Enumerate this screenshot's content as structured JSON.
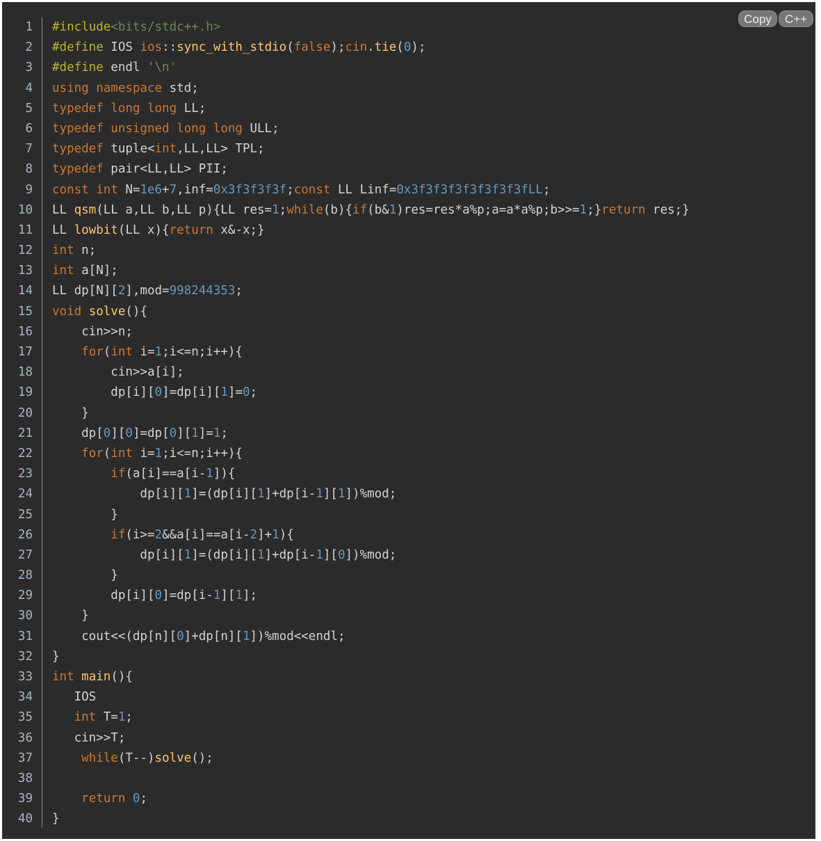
{
  "toolbar": {
    "copy_label": "Copy",
    "language_label": "C++"
  },
  "colors": {
    "background": "#2b2b2b",
    "line_numbers": "#a9b7c6",
    "keyword": "#cc7832",
    "preprocessor": "#bbb529",
    "string": "#6a8759",
    "number": "#6897bb",
    "function": "#ffc66d",
    "default": "#d4d4d4"
  },
  "lines": [
    [
      [
        "pp",
        "#include"
      ],
      [
        "hdr",
        "<bits/stdc++.h>"
      ]
    ],
    [
      [
        "pp",
        "#define"
      ],
      [
        "default",
        " IOS "
      ],
      [
        "kw",
        "ios"
      ],
      [
        "default",
        "::"
      ],
      [
        "fn",
        "sync_with_stdio"
      ],
      [
        "default",
        "("
      ],
      [
        "kw",
        "false"
      ],
      [
        "default",
        ");"
      ],
      [
        "kw",
        "cin"
      ],
      [
        "default",
        "."
      ],
      [
        "fn",
        "tie"
      ],
      [
        "default",
        "("
      ],
      [
        "num",
        "0"
      ],
      [
        "default",
        ");"
      ]
    ],
    [
      [
        "pp",
        "#define"
      ],
      [
        "default",
        " endl "
      ],
      [
        "str",
        "'\\n'"
      ]
    ],
    [
      [
        "kw",
        "using namespace"
      ],
      [
        "default",
        " std;"
      ]
    ],
    [
      [
        "kw",
        "typedef long long"
      ],
      [
        "default",
        " LL;"
      ]
    ],
    [
      [
        "kw",
        "typedef unsigned long long"
      ],
      [
        "default",
        " ULL;"
      ]
    ],
    [
      [
        "kw",
        "typedef"
      ],
      [
        "default",
        " tuple<"
      ],
      [
        "kw",
        "int"
      ],
      [
        "default",
        ",LL,LL> TPL;"
      ]
    ],
    [
      [
        "kw",
        "typedef"
      ],
      [
        "default",
        " pair<LL,LL> PII;"
      ]
    ],
    [
      [
        "kw",
        "const int"
      ],
      [
        "default",
        " N="
      ],
      [
        "num",
        "1e6"
      ],
      [
        "default",
        "+"
      ],
      [
        "num",
        "7"
      ],
      [
        "default",
        ",inf="
      ],
      [
        "num",
        "0x3f3f3f3f"
      ],
      [
        "default",
        ";"
      ],
      [
        "kw",
        "const"
      ],
      [
        "default",
        " LL Linf="
      ],
      [
        "num",
        "0x3f3f3f3f3f3f3f3fLL"
      ],
      [
        "default",
        ";"
      ]
    ],
    [
      [
        "default",
        "LL "
      ],
      [
        "fn",
        "qsm"
      ],
      [
        "default",
        "(LL a,LL b,LL p){LL res="
      ],
      [
        "num",
        "1"
      ],
      [
        "default",
        ";"
      ],
      [
        "kw",
        "while"
      ],
      [
        "default",
        "(b){"
      ],
      [
        "kw",
        "if"
      ],
      [
        "default",
        "(b&"
      ],
      [
        "num",
        "1"
      ],
      [
        "default",
        ")res=res*a%p;a=a*a%p;b>>="
      ],
      [
        "num",
        "1"
      ],
      [
        "default",
        ";}"
      ],
      [
        "kw",
        "return"
      ],
      [
        "default",
        " res;}"
      ]
    ],
    [
      [
        "default",
        "LL "
      ],
      [
        "fn",
        "lowbit"
      ],
      [
        "default",
        "(LL x){"
      ],
      [
        "kw",
        "return"
      ],
      [
        "default",
        " x&-x;}"
      ]
    ],
    [
      [
        "kw",
        "int"
      ],
      [
        "default",
        " n;"
      ]
    ],
    [
      [
        "kw",
        "int"
      ],
      [
        "default",
        " a[N];"
      ]
    ],
    [
      [
        "default",
        "LL dp[N]["
      ],
      [
        "num",
        "2"
      ],
      [
        "default",
        "],mod="
      ],
      [
        "num",
        "998244353"
      ],
      [
        "default",
        ";"
      ]
    ],
    [
      [
        "kw",
        "void"
      ],
      [
        "default",
        " "
      ],
      [
        "fn",
        "solve"
      ],
      [
        "default",
        "(){"
      ]
    ],
    [
      [
        "default",
        "    cin>>n;"
      ]
    ],
    [
      [
        "default",
        "    "
      ],
      [
        "kw",
        "for"
      ],
      [
        "default",
        "("
      ],
      [
        "kw",
        "int"
      ],
      [
        "default",
        " i="
      ],
      [
        "num",
        "1"
      ],
      [
        "default",
        ";i<=n;i++){"
      ]
    ],
    [
      [
        "default",
        "        cin>>a[i];"
      ]
    ],
    [
      [
        "default",
        "        dp[i]["
      ],
      [
        "num",
        "0"
      ],
      [
        "default",
        "]=dp[i]["
      ],
      [
        "num",
        "1"
      ],
      [
        "default",
        "]="
      ],
      [
        "num",
        "0"
      ],
      [
        "default",
        ";"
      ]
    ],
    [
      [
        "default",
        "    }"
      ]
    ],
    [
      [
        "default",
        "    dp["
      ],
      [
        "num",
        "0"
      ],
      [
        "default",
        "]["
      ],
      [
        "num",
        "0"
      ],
      [
        "default",
        "]=dp["
      ],
      [
        "num",
        "0"
      ],
      [
        "default",
        "]["
      ],
      [
        "num",
        "1"
      ],
      [
        "default",
        "]="
      ],
      [
        "num",
        "1"
      ],
      [
        "default",
        ";"
      ]
    ],
    [
      [
        "default",
        "    "
      ],
      [
        "kw",
        "for"
      ],
      [
        "default",
        "("
      ],
      [
        "kw",
        "int"
      ],
      [
        "default",
        " i="
      ],
      [
        "num",
        "1"
      ],
      [
        "default",
        ";i<=n;i++){"
      ]
    ],
    [
      [
        "default",
        "        "
      ],
      [
        "kw",
        "if"
      ],
      [
        "default",
        "(a[i]==a[i-"
      ],
      [
        "num",
        "1"
      ],
      [
        "default",
        "]){"
      ]
    ],
    [
      [
        "default",
        "            dp[i]["
      ],
      [
        "num",
        "1"
      ],
      [
        "default",
        "]=(dp[i]["
      ],
      [
        "num",
        "1"
      ],
      [
        "default",
        "]+dp[i-"
      ],
      [
        "num",
        "1"
      ],
      [
        "default",
        "]["
      ],
      [
        "num",
        "1"
      ],
      [
        "default",
        "])%mod;"
      ]
    ],
    [
      [
        "default",
        "        }"
      ]
    ],
    [
      [
        "default",
        "        "
      ],
      [
        "kw",
        "if"
      ],
      [
        "default",
        "(i>="
      ],
      [
        "num",
        "2"
      ],
      [
        "default",
        "&&a[i]==a[i-"
      ],
      [
        "num",
        "2"
      ],
      [
        "default",
        "]+"
      ],
      [
        "num",
        "1"
      ],
      [
        "default",
        "){"
      ]
    ],
    [
      [
        "default",
        "            dp[i]["
      ],
      [
        "num",
        "1"
      ],
      [
        "default",
        "]=(dp[i]["
      ],
      [
        "num",
        "1"
      ],
      [
        "default",
        "]+dp[i-"
      ],
      [
        "num",
        "1"
      ],
      [
        "default",
        "]["
      ],
      [
        "num",
        "0"
      ],
      [
        "default",
        "])%mod;"
      ]
    ],
    [
      [
        "default",
        "        }"
      ]
    ],
    [
      [
        "default",
        "        dp[i]["
      ],
      [
        "num",
        "0"
      ],
      [
        "default",
        "]=dp[i-"
      ],
      [
        "num",
        "1"
      ],
      [
        "default",
        "]["
      ],
      [
        "num",
        "1"
      ],
      [
        "default",
        "];"
      ]
    ],
    [
      [
        "default",
        "    }"
      ]
    ],
    [
      [
        "default",
        "    cout<<(dp[n]["
      ],
      [
        "num",
        "0"
      ],
      [
        "default",
        "]+dp[n]["
      ],
      [
        "num",
        "1"
      ],
      [
        "default",
        "])%mod<<endl;"
      ]
    ],
    [
      [
        "default",
        "}"
      ]
    ],
    [
      [
        "kw",
        "int"
      ],
      [
        "default",
        " "
      ],
      [
        "fn",
        "main"
      ],
      [
        "default",
        "(){"
      ]
    ],
    [
      [
        "default",
        "   IOS"
      ]
    ],
    [
      [
        "default",
        "   "
      ],
      [
        "kw",
        "int"
      ],
      [
        "default",
        " T="
      ],
      [
        "num",
        "1"
      ],
      [
        "default",
        ";"
      ]
    ],
    [
      [
        "default",
        "   cin>>T;"
      ]
    ],
    [
      [
        "default",
        "    "
      ],
      [
        "kw",
        "while"
      ],
      [
        "default",
        "(T--)"
      ],
      [
        "fn",
        "solve"
      ],
      [
        "default",
        "();"
      ]
    ],
    [
      [
        "default",
        ""
      ]
    ],
    [
      [
        "default",
        "    "
      ],
      [
        "kw",
        "return"
      ],
      [
        "default",
        " "
      ],
      [
        "num",
        "0"
      ],
      [
        "default",
        ";"
      ]
    ],
    [
      [
        "default",
        "}"
      ]
    ]
  ]
}
